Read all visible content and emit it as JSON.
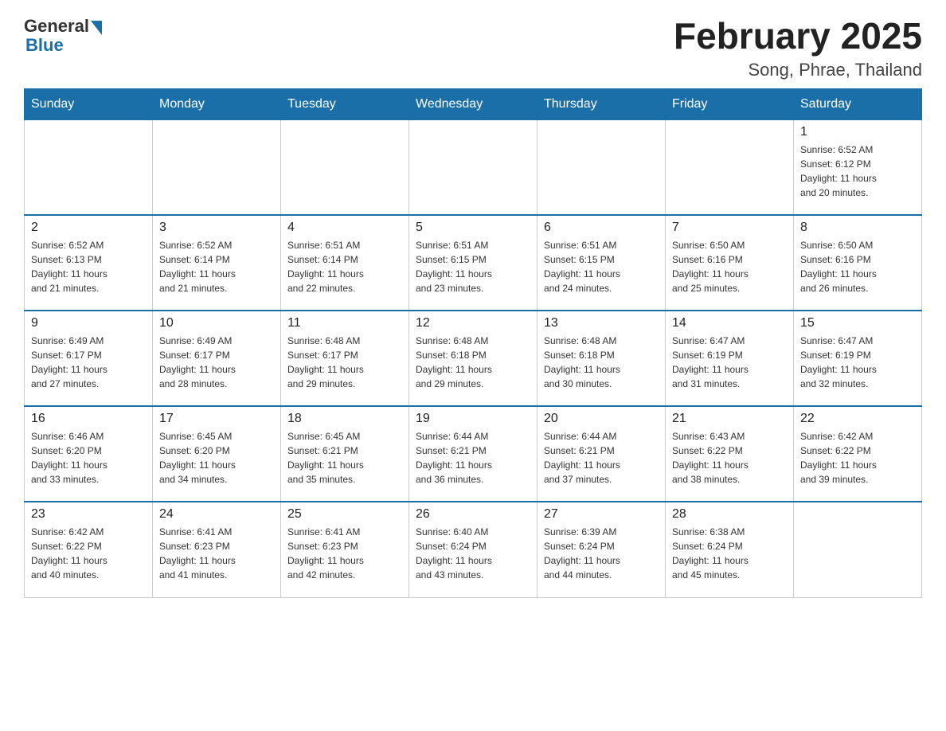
{
  "logo": {
    "general": "General",
    "blue": "Blue"
  },
  "title": "February 2025",
  "subtitle": "Song, Phrae, Thailand",
  "weekdays": [
    "Sunday",
    "Monday",
    "Tuesday",
    "Wednesday",
    "Thursday",
    "Friday",
    "Saturday"
  ],
  "weeks": [
    [
      {
        "day": "",
        "info": ""
      },
      {
        "day": "",
        "info": ""
      },
      {
        "day": "",
        "info": ""
      },
      {
        "day": "",
        "info": ""
      },
      {
        "day": "",
        "info": ""
      },
      {
        "day": "",
        "info": ""
      },
      {
        "day": "1",
        "info": "Sunrise: 6:52 AM\nSunset: 6:12 PM\nDaylight: 11 hours\nand 20 minutes."
      }
    ],
    [
      {
        "day": "2",
        "info": "Sunrise: 6:52 AM\nSunset: 6:13 PM\nDaylight: 11 hours\nand 21 minutes."
      },
      {
        "day": "3",
        "info": "Sunrise: 6:52 AM\nSunset: 6:14 PM\nDaylight: 11 hours\nand 21 minutes."
      },
      {
        "day": "4",
        "info": "Sunrise: 6:51 AM\nSunset: 6:14 PM\nDaylight: 11 hours\nand 22 minutes."
      },
      {
        "day": "5",
        "info": "Sunrise: 6:51 AM\nSunset: 6:15 PM\nDaylight: 11 hours\nand 23 minutes."
      },
      {
        "day": "6",
        "info": "Sunrise: 6:51 AM\nSunset: 6:15 PM\nDaylight: 11 hours\nand 24 minutes."
      },
      {
        "day": "7",
        "info": "Sunrise: 6:50 AM\nSunset: 6:16 PM\nDaylight: 11 hours\nand 25 minutes."
      },
      {
        "day": "8",
        "info": "Sunrise: 6:50 AM\nSunset: 6:16 PM\nDaylight: 11 hours\nand 26 minutes."
      }
    ],
    [
      {
        "day": "9",
        "info": "Sunrise: 6:49 AM\nSunset: 6:17 PM\nDaylight: 11 hours\nand 27 minutes."
      },
      {
        "day": "10",
        "info": "Sunrise: 6:49 AM\nSunset: 6:17 PM\nDaylight: 11 hours\nand 28 minutes."
      },
      {
        "day": "11",
        "info": "Sunrise: 6:48 AM\nSunset: 6:17 PM\nDaylight: 11 hours\nand 29 minutes."
      },
      {
        "day": "12",
        "info": "Sunrise: 6:48 AM\nSunset: 6:18 PM\nDaylight: 11 hours\nand 29 minutes."
      },
      {
        "day": "13",
        "info": "Sunrise: 6:48 AM\nSunset: 6:18 PM\nDaylight: 11 hours\nand 30 minutes."
      },
      {
        "day": "14",
        "info": "Sunrise: 6:47 AM\nSunset: 6:19 PM\nDaylight: 11 hours\nand 31 minutes."
      },
      {
        "day": "15",
        "info": "Sunrise: 6:47 AM\nSunset: 6:19 PM\nDaylight: 11 hours\nand 32 minutes."
      }
    ],
    [
      {
        "day": "16",
        "info": "Sunrise: 6:46 AM\nSunset: 6:20 PM\nDaylight: 11 hours\nand 33 minutes."
      },
      {
        "day": "17",
        "info": "Sunrise: 6:45 AM\nSunset: 6:20 PM\nDaylight: 11 hours\nand 34 minutes."
      },
      {
        "day": "18",
        "info": "Sunrise: 6:45 AM\nSunset: 6:21 PM\nDaylight: 11 hours\nand 35 minutes."
      },
      {
        "day": "19",
        "info": "Sunrise: 6:44 AM\nSunset: 6:21 PM\nDaylight: 11 hours\nand 36 minutes."
      },
      {
        "day": "20",
        "info": "Sunrise: 6:44 AM\nSunset: 6:21 PM\nDaylight: 11 hours\nand 37 minutes."
      },
      {
        "day": "21",
        "info": "Sunrise: 6:43 AM\nSunset: 6:22 PM\nDaylight: 11 hours\nand 38 minutes."
      },
      {
        "day": "22",
        "info": "Sunrise: 6:42 AM\nSunset: 6:22 PM\nDaylight: 11 hours\nand 39 minutes."
      }
    ],
    [
      {
        "day": "23",
        "info": "Sunrise: 6:42 AM\nSunset: 6:22 PM\nDaylight: 11 hours\nand 40 minutes."
      },
      {
        "day": "24",
        "info": "Sunrise: 6:41 AM\nSunset: 6:23 PM\nDaylight: 11 hours\nand 41 minutes."
      },
      {
        "day": "25",
        "info": "Sunrise: 6:41 AM\nSunset: 6:23 PM\nDaylight: 11 hours\nand 42 minutes."
      },
      {
        "day": "26",
        "info": "Sunrise: 6:40 AM\nSunset: 6:24 PM\nDaylight: 11 hours\nand 43 minutes."
      },
      {
        "day": "27",
        "info": "Sunrise: 6:39 AM\nSunset: 6:24 PM\nDaylight: 11 hours\nand 44 minutes."
      },
      {
        "day": "28",
        "info": "Sunrise: 6:38 AM\nSunset: 6:24 PM\nDaylight: 11 hours\nand 45 minutes."
      },
      {
        "day": "",
        "info": ""
      }
    ]
  ]
}
